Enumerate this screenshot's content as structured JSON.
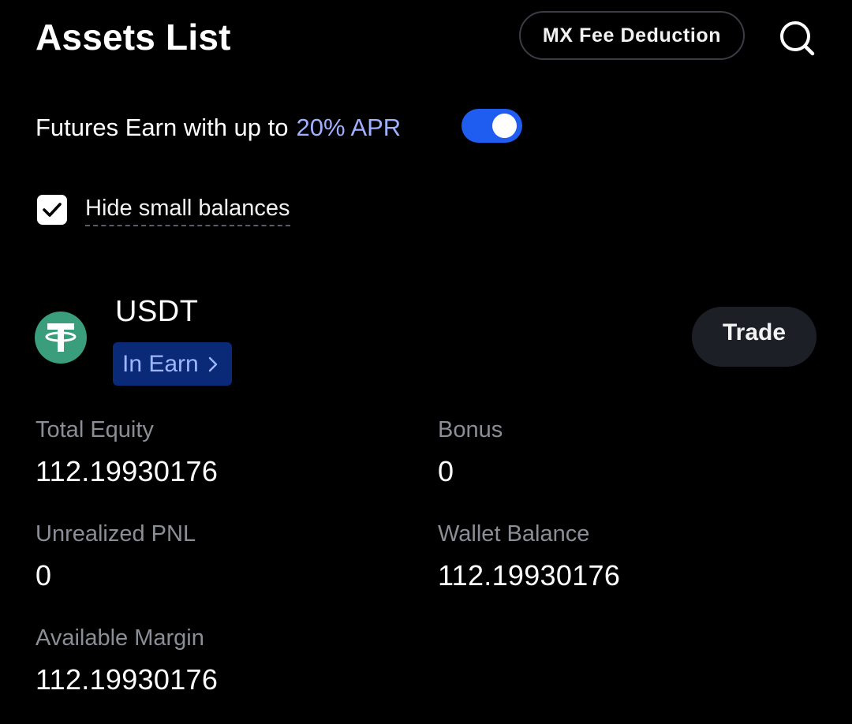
{
  "header": {
    "title": "Assets List",
    "fee_button_label": "MX Fee Deduction",
    "search_icon": "search-icon"
  },
  "promo": {
    "text": "Futures Earn with up to",
    "highlight": "20% APR",
    "highlight_color": "#9fb0ff",
    "toggle_on": true,
    "toggle_color": "#1f5cf0"
  },
  "filter": {
    "hide_small_label": "Hide small balances",
    "checked": true
  },
  "asset": {
    "symbol": "USDT",
    "logo_icon": "tether-icon",
    "logo_color": "#3a9d7c",
    "earn_badge_label": "In Earn",
    "trade_label": "Trade",
    "stats": {
      "total_equity": {
        "label": "Total Equity",
        "value": "112.19930176"
      },
      "bonus": {
        "label": "Bonus",
        "value": "0"
      },
      "unrealized_pnl": {
        "label": "Unrealized PNL",
        "value": "0"
      },
      "wallet_balance": {
        "label": "Wallet Balance",
        "value": "112.19930176"
      },
      "available_margin": {
        "label": "Available Margin",
        "value": "112.19930176"
      }
    }
  }
}
